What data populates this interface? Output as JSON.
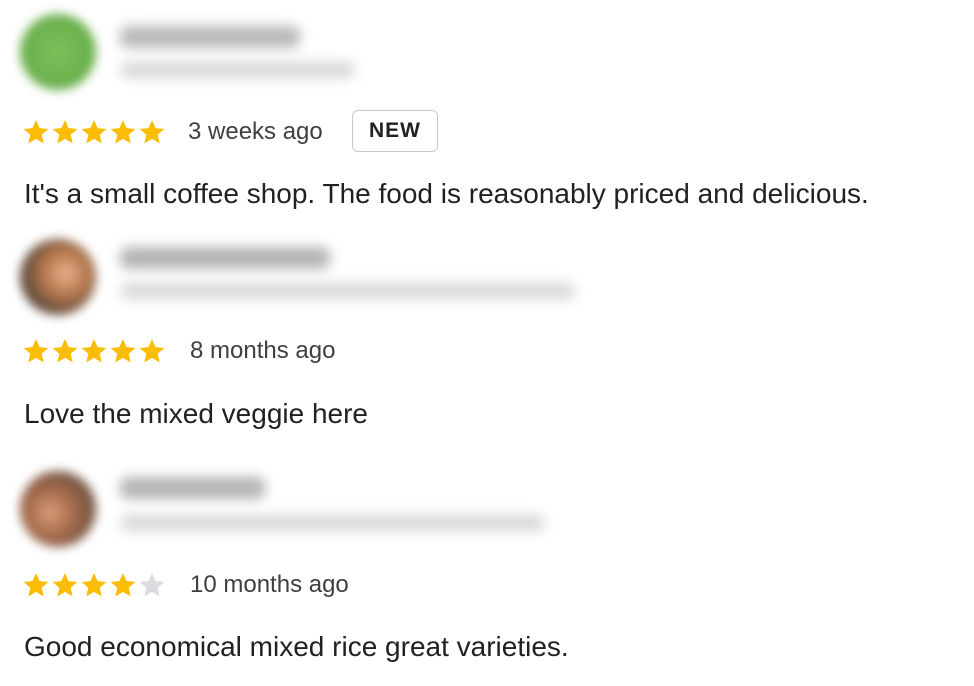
{
  "reviews": [
    {
      "rating": 5,
      "time": "3 weeks ago",
      "badge": "NEW",
      "text": "It's a small coffee shop. The food is reasonably priced and delicious."
    },
    {
      "rating": 5,
      "time": "8 months ago",
      "text": "Love the mixed veggie here"
    },
    {
      "rating": 4,
      "time": "10 months ago",
      "text": "Good economical mixed rice great varieties."
    }
  ],
  "colors": {
    "star_filled": "#fbbc04",
    "star_empty": "#dadce0",
    "badge_border": "#c8c8c8"
  }
}
